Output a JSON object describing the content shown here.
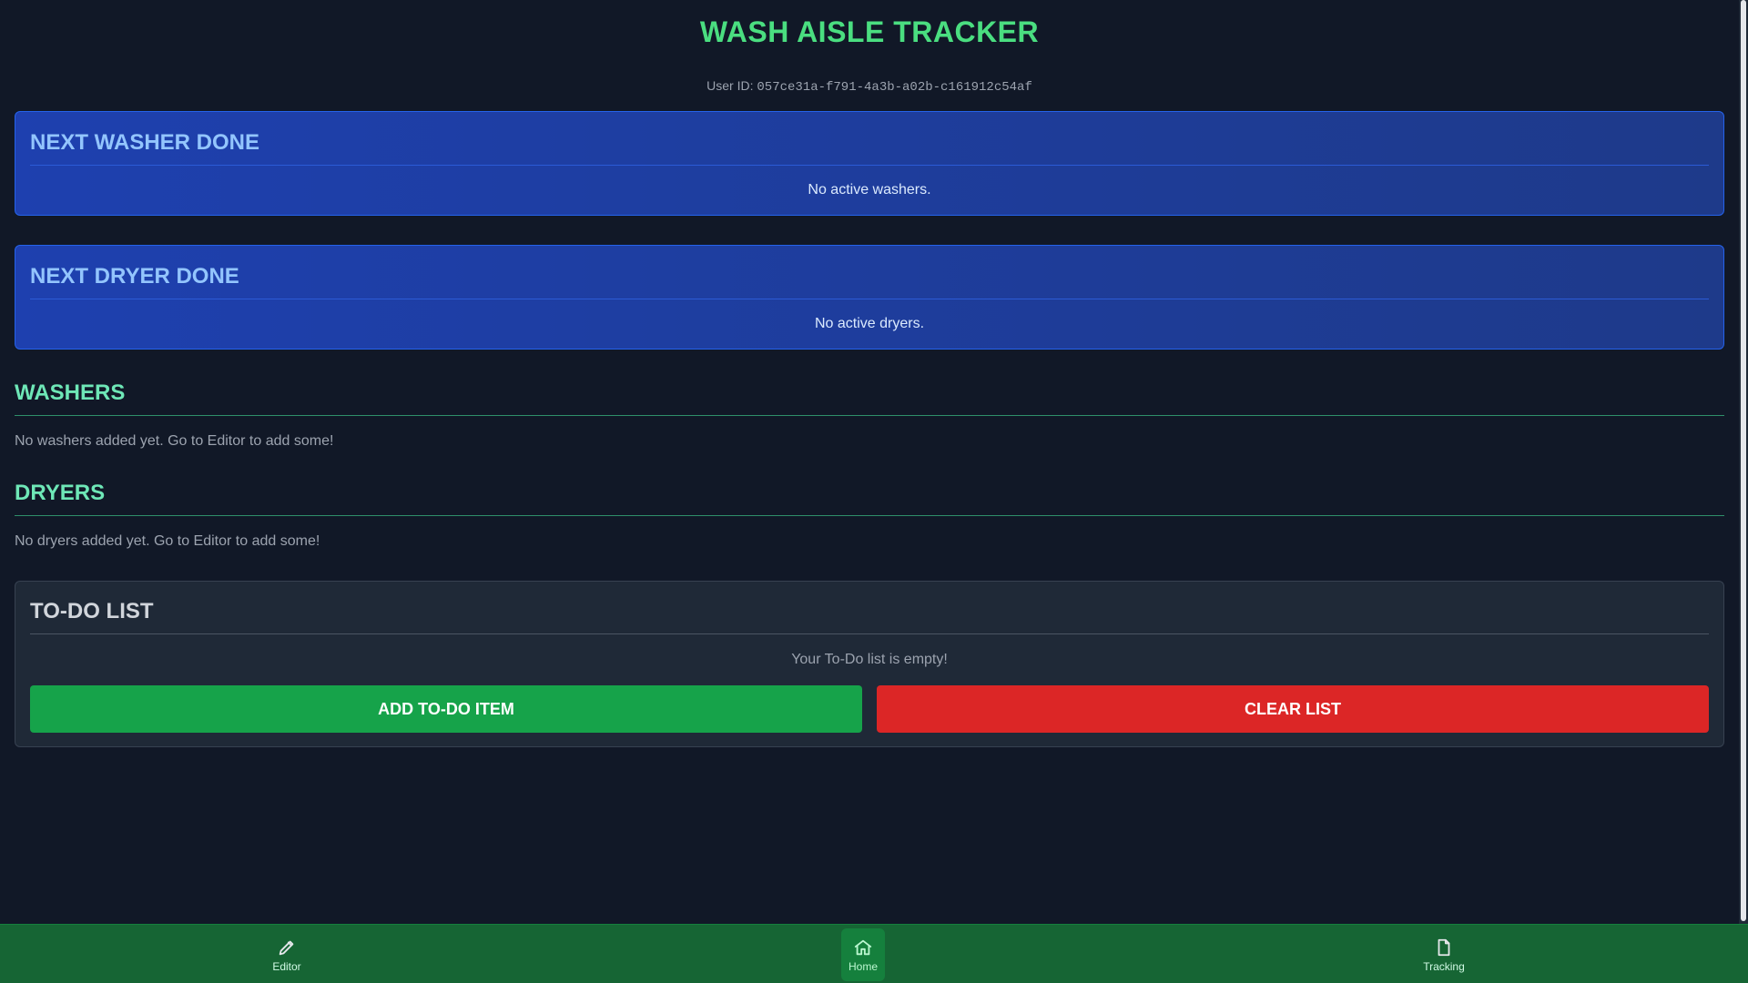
{
  "header": {
    "title": "WASH AISLE TRACKER",
    "user_id_label": "User ID:",
    "user_id_value": "057ce31a-f791-4a3b-a02b-c161912c54af"
  },
  "next_washer": {
    "title": "NEXT WASHER DONE",
    "empty_text": "No active washers."
  },
  "next_dryer": {
    "title": "NEXT DRYER DONE",
    "empty_text": "No active dryers."
  },
  "washers": {
    "title": "WASHERS",
    "empty_text": "No washers added yet. Go to Editor to add some!"
  },
  "dryers": {
    "title": "DRYERS",
    "empty_text": "No dryers added yet. Go to Editor to add some!"
  },
  "todo": {
    "title": "TO-DO LIST",
    "empty_text": "Your To-Do list is empty!",
    "add_label": "ADD TO-DO ITEM",
    "clear_label": "CLEAR LIST"
  },
  "nav": {
    "items": [
      {
        "label": "Editor",
        "icon": "pencil-icon"
      },
      {
        "label": "Home",
        "icon": "home-icon",
        "active": true
      },
      {
        "label": "Tracking",
        "icon": "document-icon"
      }
    ]
  },
  "colors": {
    "background": "#111827",
    "accent_green": "#4ade80",
    "card_blue": "#1e40af",
    "add_button": "#16a34a",
    "clear_button": "#dc2626",
    "nav_background": "#166534"
  }
}
